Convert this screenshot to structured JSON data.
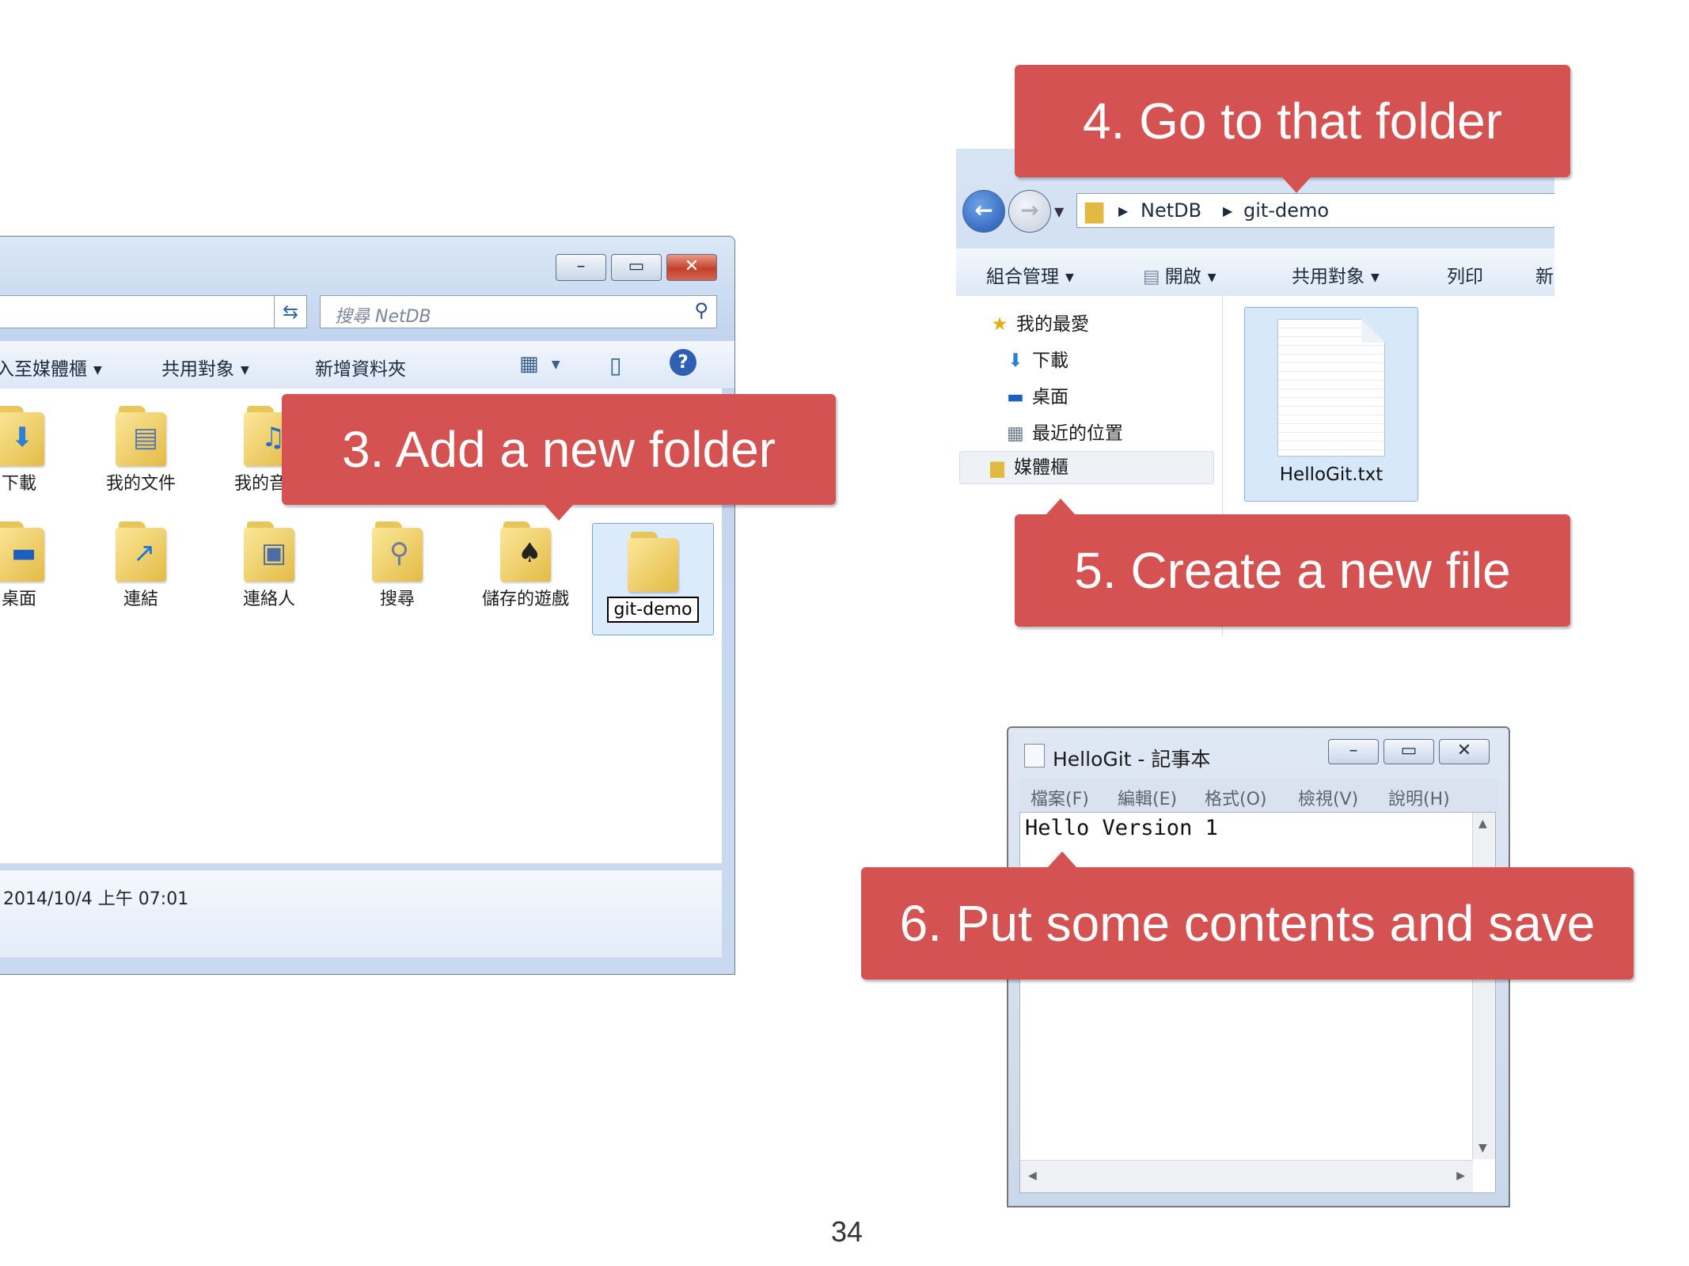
{
  "explorer1": {
    "search_placeholder": "搜尋 NetDB",
    "commands": [
      "加入至媒體櫃",
      "共用對象",
      "新增資料夾"
    ],
    "items": [
      {
        "label": "下載",
        "icon": "download-folder-icon"
      },
      {
        "label": "我的文件",
        "icon": "documents-folder-icon"
      },
      {
        "label": "我的音樂",
        "icon": "music-folder-icon"
      },
      {
        "label": "桌面",
        "icon": "desktop-icon"
      },
      {
        "label": "連結",
        "icon": "links-folder-icon"
      },
      {
        "label": "連絡人",
        "icon": "contacts-folder-icon"
      },
      {
        "label": "搜尋",
        "icon": "search-folder-icon"
      },
      {
        "label": "儲存的遊戲",
        "icon": "saved-games-folder-icon"
      }
    ],
    "new_folder_name": "git-demo",
    "details_date": "2014/10/4 上午 07:01"
  },
  "explorer2": {
    "breadcrumb": [
      "NetDB",
      "git-demo"
    ],
    "commands": [
      "組合管理",
      "開啟",
      "共用對象",
      "列印",
      "新"
    ],
    "nav_items": [
      "我的最愛",
      "下載",
      "桌面",
      "最近的位置",
      "媒體櫃"
    ],
    "file_name": "HelloGit.txt"
  },
  "notepad": {
    "title": "HelloGit - 記事本",
    "menu": [
      "檔案(F)",
      "編輯(E)",
      "格式(O)",
      "檢視(V)",
      "說明(H)"
    ],
    "content": "Hello Version 1"
  },
  "callouts": {
    "step3": "3. Add a new folder",
    "step4": "4. Go to that folder",
    "step5": "5. Create a new file",
    "step6": "6. Put some contents and save"
  },
  "page_number": "34",
  "colors": {
    "callout": "#d45251",
    "selection": "#dcebfc"
  }
}
